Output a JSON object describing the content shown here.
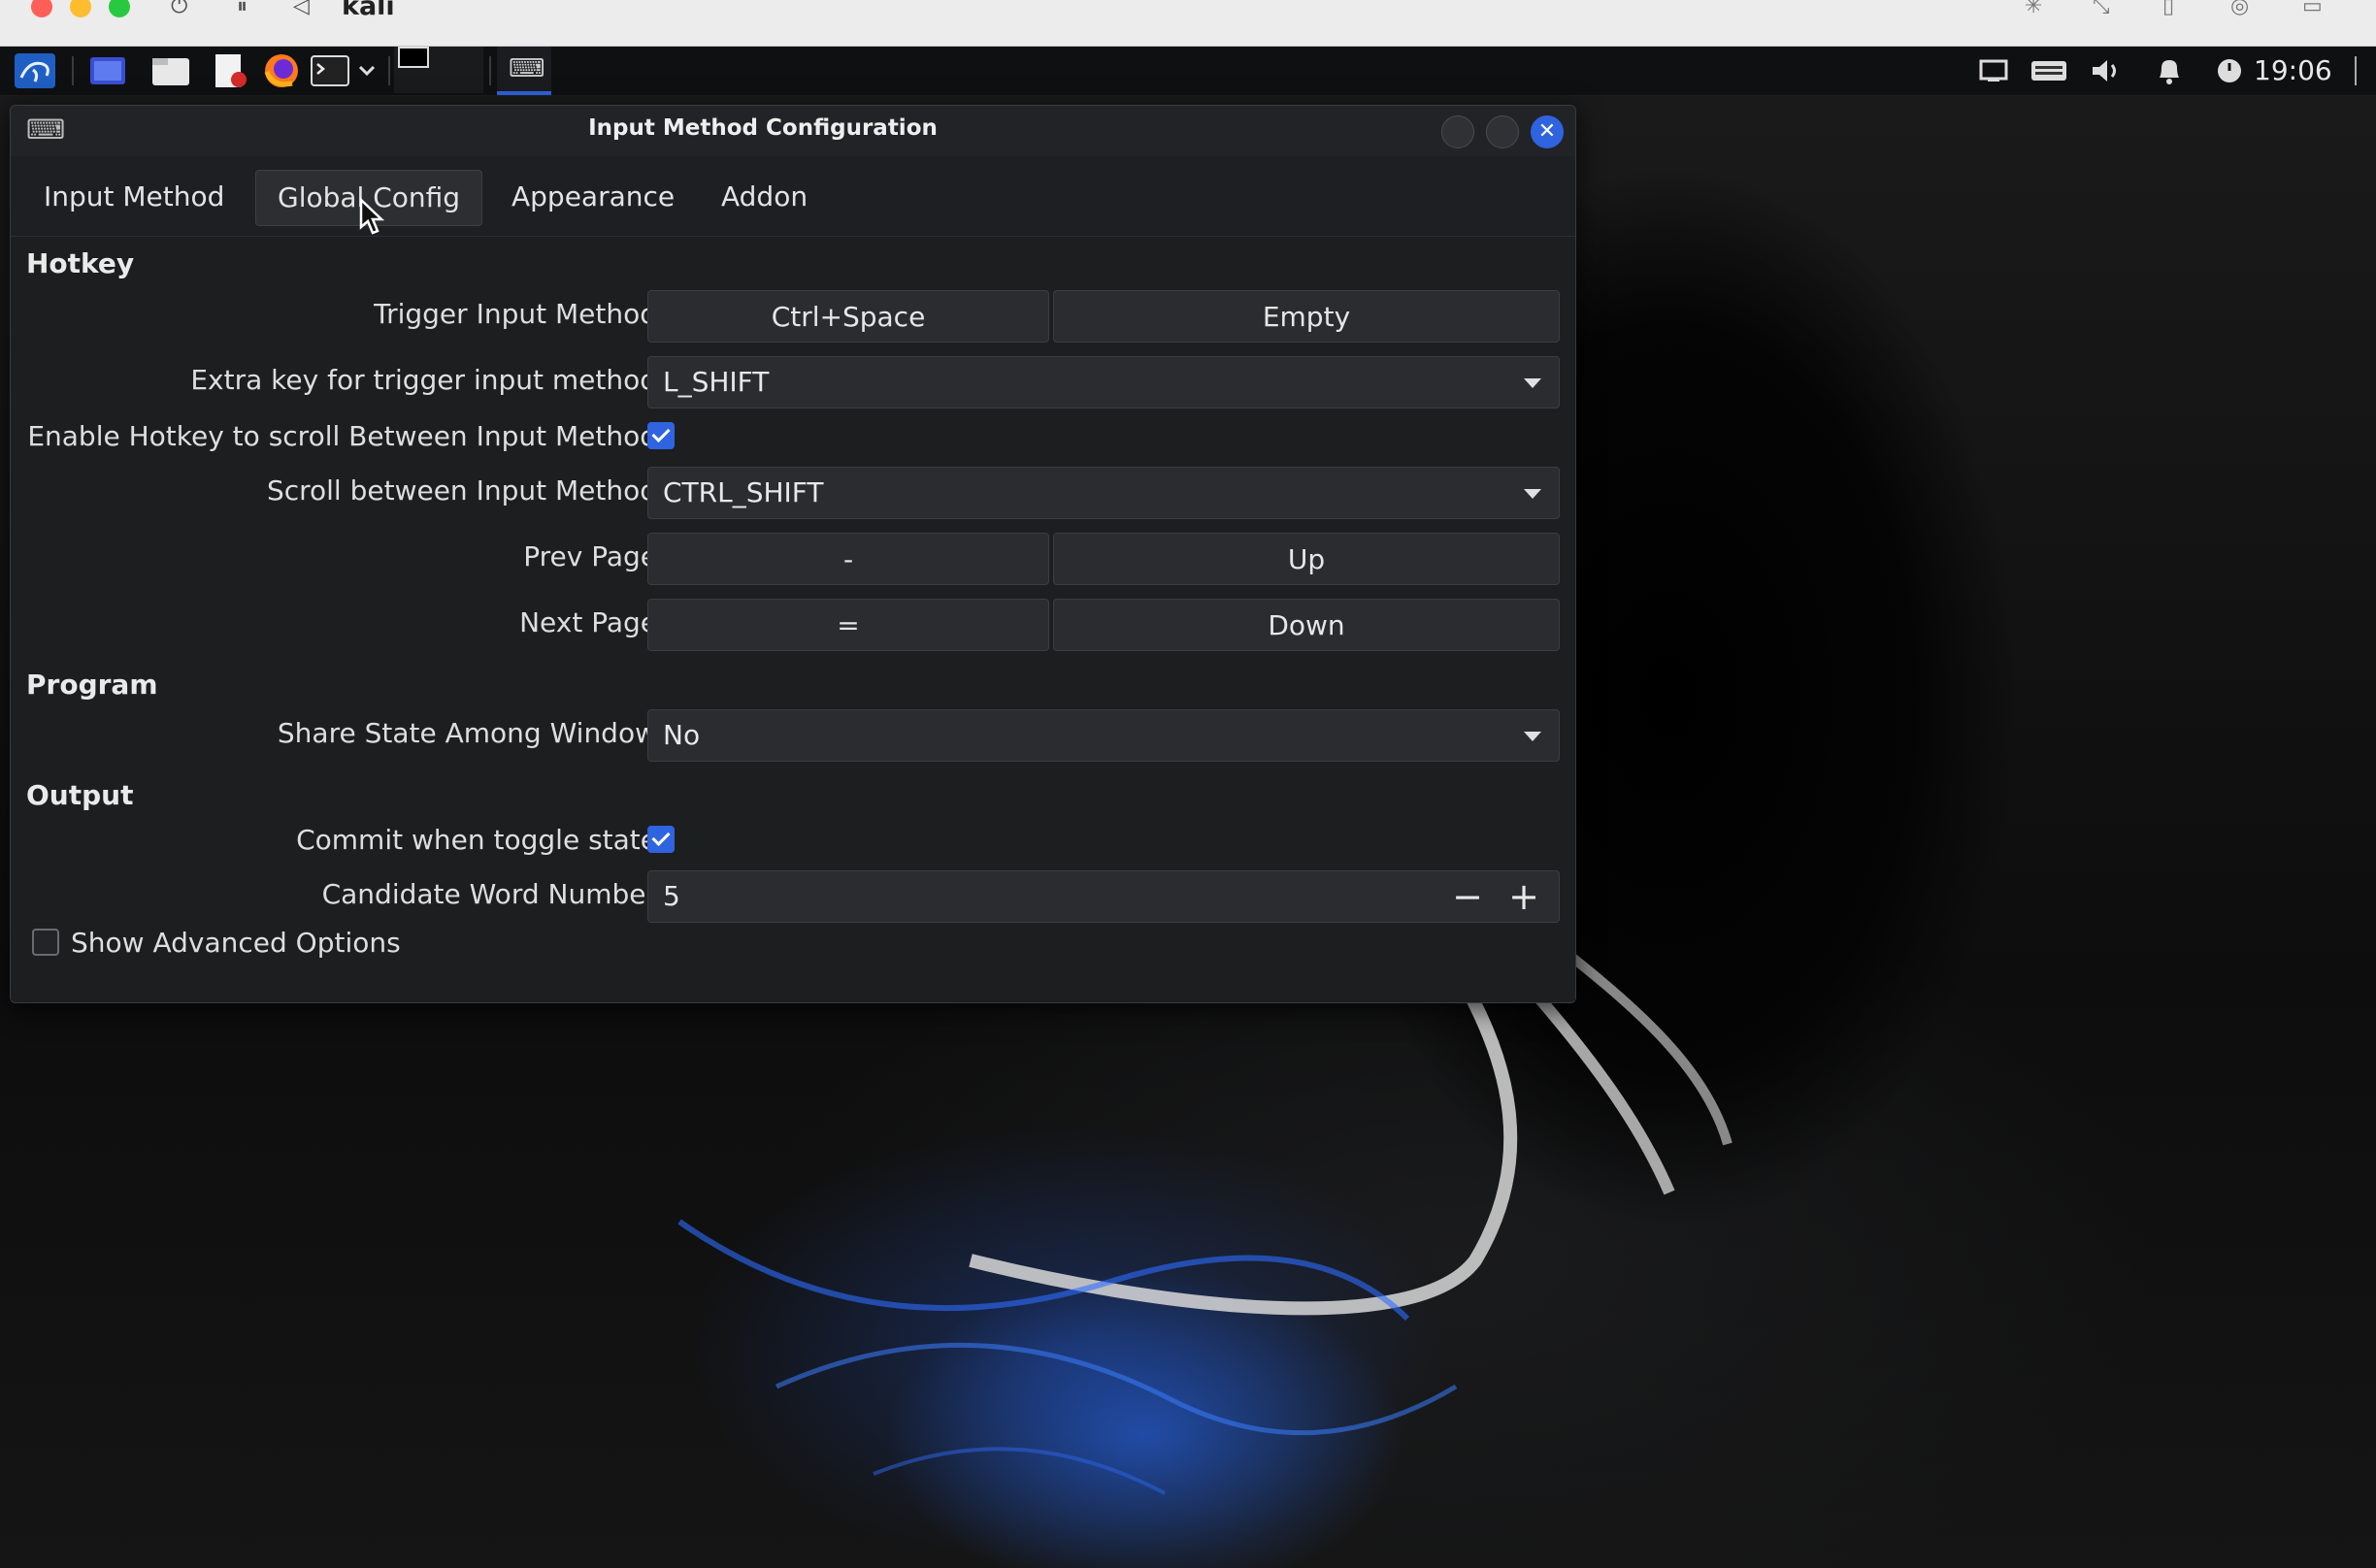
{
  "host": {
    "title": "kali"
  },
  "panel": {
    "clock": "19:06",
    "icons": [
      "kali-menu-icon",
      "workspace-icon",
      "files-icon",
      "text-editor-icon",
      "firefox-icon",
      "terminal-icon",
      "chevron-down-icon",
      "keyboard-indicator-icon",
      "display-icon",
      "keyboard-icon",
      "volume-icon",
      "bell-icon",
      "power-icon"
    ]
  },
  "window": {
    "title": "Input Method Configuration",
    "tabs": [
      {
        "label": "Input Method"
      },
      {
        "label": "Global Config"
      },
      {
        "label": "Appearance"
      },
      {
        "label": "Addon"
      }
    ],
    "active_tab": "Global Config",
    "hotkey": {
      "section": "Hotkey",
      "trigger_label": "Trigger Input Method",
      "trigger_key1": "Ctrl+Space",
      "trigger_key2": "Empty",
      "extra_label": "Extra key for trigger input method",
      "extra_value": "L_SHIFT",
      "enable_scroll_label": "Enable Hotkey to scroll Between Input Method",
      "enable_scroll_checked": true,
      "scroll_label": "Scroll between Input Method",
      "scroll_value": "CTRL_SHIFT",
      "prev_label": "Prev Page",
      "prev_key1": "-",
      "prev_key2": "Up",
      "next_label": "Next Page",
      "next_key1": "=",
      "next_key2": "Down"
    },
    "program": {
      "section": "Program",
      "share_label": "Share State Among Window",
      "share_value": "No"
    },
    "output": {
      "section": "Output",
      "commit_label": "Commit when toggle state",
      "commit_checked": true,
      "candidate_label": "Candidate Word Number",
      "candidate_value": "5"
    },
    "advanced_label": "Show Advanced Options",
    "advanced_checked": false
  },
  "colors": {
    "accent": "#2f63e0",
    "window_bg": "#1d1e20",
    "panel_bg": "#0f1011"
  }
}
